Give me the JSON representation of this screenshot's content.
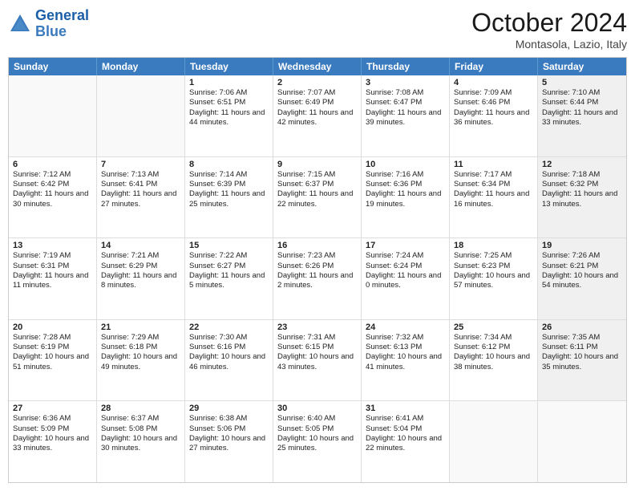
{
  "header": {
    "logo_general": "General",
    "logo_blue": "Blue",
    "month_title": "October 2024",
    "location": "Montasola, Lazio, Italy"
  },
  "days_of_week": [
    "Sunday",
    "Monday",
    "Tuesday",
    "Wednesday",
    "Thursday",
    "Friday",
    "Saturday"
  ],
  "weeks": [
    [
      {
        "day": "",
        "sunrise": "",
        "sunset": "",
        "daylight": "",
        "empty": true
      },
      {
        "day": "",
        "sunrise": "",
        "sunset": "",
        "daylight": "",
        "empty": true
      },
      {
        "day": "1",
        "sunrise": "Sunrise: 7:06 AM",
        "sunset": "Sunset: 6:51 PM",
        "daylight": "Daylight: 11 hours and 44 minutes."
      },
      {
        "day": "2",
        "sunrise": "Sunrise: 7:07 AM",
        "sunset": "Sunset: 6:49 PM",
        "daylight": "Daylight: 11 hours and 42 minutes."
      },
      {
        "day": "3",
        "sunrise": "Sunrise: 7:08 AM",
        "sunset": "Sunset: 6:47 PM",
        "daylight": "Daylight: 11 hours and 39 minutes."
      },
      {
        "day": "4",
        "sunrise": "Sunrise: 7:09 AM",
        "sunset": "Sunset: 6:46 PM",
        "daylight": "Daylight: 11 hours and 36 minutes."
      },
      {
        "day": "5",
        "sunrise": "Sunrise: 7:10 AM",
        "sunset": "Sunset: 6:44 PM",
        "daylight": "Daylight: 11 hours and 33 minutes.",
        "shaded": true
      }
    ],
    [
      {
        "day": "6",
        "sunrise": "Sunrise: 7:12 AM",
        "sunset": "Sunset: 6:42 PM",
        "daylight": "Daylight: 11 hours and 30 minutes."
      },
      {
        "day": "7",
        "sunrise": "Sunrise: 7:13 AM",
        "sunset": "Sunset: 6:41 PM",
        "daylight": "Daylight: 11 hours and 27 minutes."
      },
      {
        "day": "8",
        "sunrise": "Sunrise: 7:14 AM",
        "sunset": "Sunset: 6:39 PM",
        "daylight": "Daylight: 11 hours and 25 minutes."
      },
      {
        "day": "9",
        "sunrise": "Sunrise: 7:15 AM",
        "sunset": "Sunset: 6:37 PM",
        "daylight": "Daylight: 11 hours and 22 minutes."
      },
      {
        "day": "10",
        "sunrise": "Sunrise: 7:16 AM",
        "sunset": "Sunset: 6:36 PM",
        "daylight": "Daylight: 11 hours and 19 minutes."
      },
      {
        "day": "11",
        "sunrise": "Sunrise: 7:17 AM",
        "sunset": "Sunset: 6:34 PM",
        "daylight": "Daylight: 11 hours and 16 minutes."
      },
      {
        "day": "12",
        "sunrise": "Sunrise: 7:18 AM",
        "sunset": "Sunset: 6:32 PM",
        "daylight": "Daylight: 11 hours and 13 minutes.",
        "shaded": true
      }
    ],
    [
      {
        "day": "13",
        "sunrise": "Sunrise: 7:19 AM",
        "sunset": "Sunset: 6:31 PM",
        "daylight": "Daylight: 11 hours and 11 minutes."
      },
      {
        "day": "14",
        "sunrise": "Sunrise: 7:21 AM",
        "sunset": "Sunset: 6:29 PM",
        "daylight": "Daylight: 11 hours and 8 minutes."
      },
      {
        "day": "15",
        "sunrise": "Sunrise: 7:22 AM",
        "sunset": "Sunset: 6:27 PM",
        "daylight": "Daylight: 11 hours and 5 minutes."
      },
      {
        "day": "16",
        "sunrise": "Sunrise: 7:23 AM",
        "sunset": "Sunset: 6:26 PM",
        "daylight": "Daylight: 11 hours and 2 minutes."
      },
      {
        "day": "17",
        "sunrise": "Sunrise: 7:24 AM",
        "sunset": "Sunset: 6:24 PM",
        "daylight": "Daylight: 11 hours and 0 minutes."
      },
      {
        "day": "18",
        "sunrise": "Sunrise: 7:25 AM",
        "sunset": "Sunset: 6:23 PM",
        "daylight": "Daylight: 10 hours and 57 minutes."
      },
      {
        "day": "19",
        "sunrise": "Sunrise: 7:26 AM",
        "sunset": "Sunset: 6:21 PM",
        "daylight": "Daylight: 10 hours and 54 minutes.",
        "shaded": true
      }
    ],
    [
      {
        "day": "20",
        "sunrise": "Sunrise: 7:28 AM",
        "sunset": "Sunset: 6:19 PM",
        "daylight": "Daylight: 10 hours and 51 minutes."
      },
      {
        "day": "21",
        "sunrise": "Sunrise: 7:29 AM",
        "sunset": "Sunset: 6:18 PM",
        "daylight": "Daylight: 10 hours and 49 minutes."
      },
      {
        "day": "22",
        "sunrise": "Sunrise: 7:30 AM",
        "sunset": "Sunset: 6:16 PM",
        "daylight": "Daylight: 10 hours and 46 minutes."
      },
      {
        "day": "23",
        "sunrise": "Sunrise: 7:31 AM",
        "sunset": "Sunset: 6:15 PM",
        "daylight": "Daylight: 10 hours and 43 minutes."
      },
      {
        "day": "24",
        "sunrise": "Sunrise: 7:32 AM",
        "sunset": "Sunset: 6:13 PM",
        "daylight": "Daylight: 10 hours and 41 minutes."
      },
      {
        "day": "25",
        "sunrise": "Sunrise: 7:34 AM",
        "sunset": "Sunset: 6:12 PM",
        "daylight": "Daylight: 10 hours and 38 minutes."
      },
      {
        "day": "26",
        "sunrise": "Sunrise: 7:35 AM",
        "sunset": "Sunset: 6:11 PM",
        "daylight": "Daylight: 10 hours and 35 minutes.",
        "shaded": true
      }
    ],
    [
      {
        "day": "27",
        "sunrise": "Sunrise: 6:36 AM",
        "sunset": "Sunset: 5:09 PM",
        "daylight": "Daylight: 10 hours and 33 minutes."
      },
      {
        "day": "28",
        "sunrise": "Sunrise: 6:37 AM",
        "sunset": "Sunset: 5:08 PM",
        "daylight": "Daylight: 10 hours and 30 minutes."
      },
      {
        "day": "29",
        "sunrise": "Sunrise: 6:38 AM",
        "sunset": "Sunset: 5:06 PM",
        "daylight": "Daylight: 10 hours and 27 minutes."
      },
      {
        "day": "30",
        "sunrise": "Sunrise: 6:40 AM",
        "sunset": "Sunset: 5:05 PM",
        "daylight": "Daylight: 10 hours and 25 minutes."
      },
      {
        "day": "31",
        "sunrise": "Sunrise: 6:41 AM",
        "sunset": "Sunset: 5:04 PM",
        "daylight": "Daylight: 10 hours and 22 minutes."
      },
      {
        "day": "",
        "sunrise": "",
        "sunset": "",
        "daylight": "",
        "empty": true
      },
      {
        "day": "",
        "sunrise": "",
        "sunset": "",
        "daylight": "",
        "empty": true,
        "shaded": true
      }
    ]
  ]
}
